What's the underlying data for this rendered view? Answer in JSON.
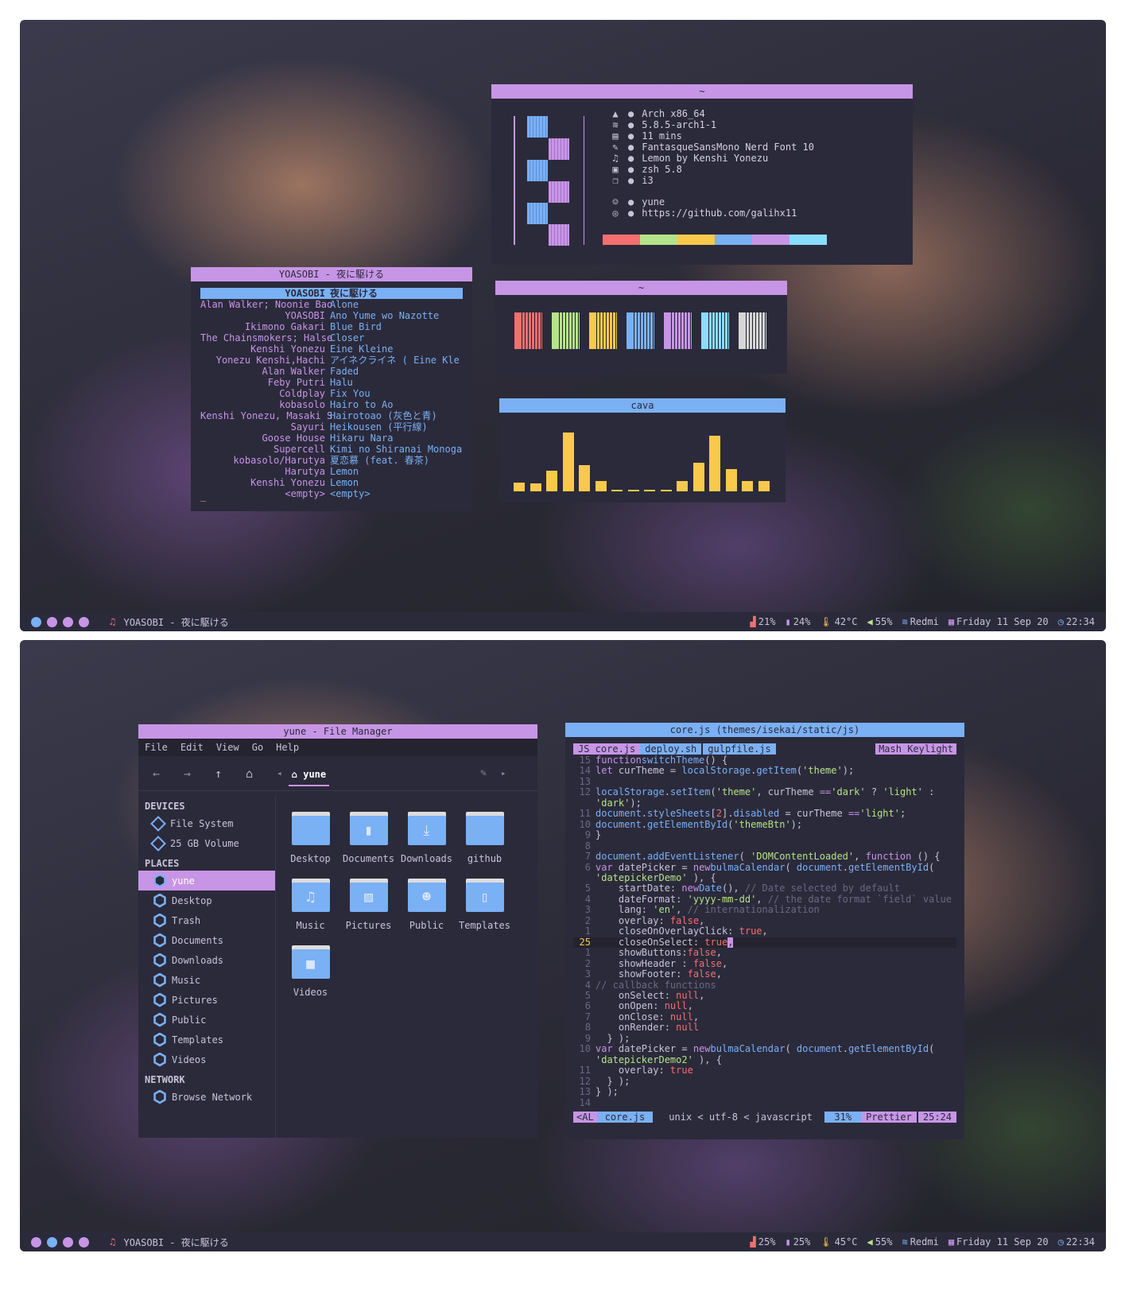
{
  "colors": {
    "purple": "#c795e6",
    "blue": "#7ab0f4",
    "yellow": "#f8c94b",
    "bg": "#2b2a3b"
  },
  "top": {
    "bar": {
      "workspaces": [
        "#7ab0f4",
        "#c795e6",
        "#c795e6",
        "#c795e6"
      ],
      "now_playing": "YOASOBI - 夜に駆ける",
      "cpu": "21%",
      "mem": "24%",
      "temp": "42°C",
      "volume": "55%",
      "wifi": "Redmi",
      "date": "Friday 11 Sep 20",
      "time": "22:34"
    },
    "music": {
      "title": "YOASOBI - 夜に駆ける",
      "rows": [
        {
          "artist": "YOASOBI",
          "track": "夜に駆ける",
          "selected": true
        },
        {
          "artist": "Alan Walker; Noonie Bao",
          "track": "Alone"
        },
        {
          "artist": "YOASOBI",
          "track": "Ano Yume wo Nazotte"
        },
        {
          "artist": "Ikimono Gakari",
          "track": "Blue Bird"
        },
        {
          "artist": "The Chainsmokers; Halse",
          "track": "Closer"
        },
        {
          "artist": "Kenshi Yonezu",
          "track": "Eine Kleine"
        },
        {
          "artist": "Yonezu Kenshi,Hachi",
          "track": "アイネクライネ ( Eine Kle"
        },
        {
          "artist": "Alan Walker",
          "track": "Faded"
        },
        {
          "artist": "Feby Putri",
          "track": "Halu"
        },
        {
          "artist": "Coldplay",
          "track": "Fix You"
        },
        {
          "artist": "kobasolo",
          "track": "Hairo to Ao"
        },
        {
          "artist": "Kenshi Yonezu, Masaki S",
          "track": "Hairotoao (灰色と青)"
        },
        {
          "artist": "Sayuri",
          "track": "Heikousen (平行線)"
        },
        {
          "artist": "Goose House",
          "track": "Hikaru Nara"
        },
        {
          "artist": "Supercell",
          "track": "Kimi no Shiranai Monogata"
        },
        {
          "artist": "kobasolo/Harutya",
          "track": "夏恋慕 (feat. 春茶)"
        },
        {
          "artist": "Harutya",
          "track": "Lemon"
        },
        {
          "artist": "Kenshi Yonezu",
          "track": "Lemon"
        },
        {
          "artist": "<empty>",
          "track": "<empty>"
        }
      ],
      "cursor": "_"
    },
    "neofetch": {
      "title": "~",
      "lines": [
        {
          "icon": "arch-icon",
          "glyph": "▲",
          "text": "Arch x86_64"
        },
        {
          "icon": "kernel-icon",
          "glyph": "≋",
          "text": "5.8.5-arch1-1"
        },
        {
          "icon": "uptime-icon",
          "glyph": "▤",
          "text": "11 mins"
        },
        {
          "icon": "font-icon",
          "glyph": "✎",
          "text": "FantasqueSansMono Nerd Font 10"
        },
        {
          "icon": "music-icon",
          "glyph": "♫",
          "text": "Lemon by Kenshi Yonezu"
        },
        {
          "icon": "shell-icon",
          "glyph": "▣",
          "text": "zsh 5.8"
        },
        {
          "icon": "wm-icon",
          "glyph": "❐",
          "text": "i3"
        },
        {
          "icon": "user-icon",
          "glyph": "☺",
          "text": "yune"
        },
        {
          "icon": "github-icon",
          "glyph": "◎",
          "text": "https://github.com/galihx11"
        }
      ],
      "palette": [
        "#f46f6f",
        "#b5e488",
        "#f8c94b",
        "#7ab0f4",
        "#c795e6",
        "#89ddff"
      ]
    },
    "colors_win": {
      "title": "~",
      "swatches": [
        "#f46f6f",
        "#b5e488",
        "#f8c94b",
        "#7ab0f4",
        "#c795e6",
        "#89ddff",
        "#d6d6d6"
      ]
    },
    "cava": {
      "title": "cava",
      "values": [
        0.15,
        0.13,
        0.35,
        1.0,
        0.44,
        0.17,
        0.02,
        0.02,
        0.02,
        0.02,
        0.17,
        0.48,
        0.95,
        0.38,
        0.17,
        0.17
      ]
    }
  },
  "bottom": {
    "bar": {
      "workspaces": [
        "#c795e6",
        "#7ab0f4",
        "#c795e6",
        "#c795e6"
      ],
      "now_playing": "YOASOBI - 夜に駆ける",
      "cpu": "25%",
      "mem": "25%",
      "temp": "45°C",
      "volume": "55%",
      "wifi": "Redmi",
      "date": "Friday 11 Sep 20",
      "time": "22:34"
    },
    "fm": {
      "title": "yune - File Manager",
      "menu": [
        "File",
        "Edit",
        "View",
        "Go",
        "Help"
      ],
      "path": "yune",
      "devices_header": "DEVICES",
      "devices": [
        "File System",
        "25 GB Volume"
      ],
      "places_header": "PLACES",
      "places": [
        "yune",
        "Desktop",
        "Trash",
        "Documents",
        "Downloads",
        "Music",
        "Pictures",
        "Public",
        "Templates",
        "Videos"
      ],
      "network_header": "NETWORK",
      "network": [
        "Browse Network"
      ],
      "files": [
        {
          "name": "Desktop",
          "icon": "folder-desktop-icon",
          "glyph": ""
        },
        {
          "name": "Documents",
          "icon": "folder-documents-icon",
          "glyph": "▮"
        },
        {
          "name": "Downloads",
          "icon": "folder-downloads-icon",
          "glyph": "⤓"
        },
        {
          "name": "github",
          "icon": "folder-icon",
          "glyph": ""
        },
        {
          "name": "Music",
          "icon": "folder-music-icon",
          "glyph": "♫"
        },
        {
          "name": "Pictures",
          "icon": "folder-pictures-icon",
          "glyph": "▨"
        },
        {
          "name": "Public",
          "icon": "folder-public-icon",
          "glyph": "☻"
        },
        {
          "name": "Templates",
          "icon": "folder-templates-icon",
          "glyph": "▯"
        },
        {
          "name": "Videos",
          "icon": "folder-videos-icon",
          "glyph": "■"
        }
      ]
    },
    "editor": {
      "title": "core.js (themes/isekai/static/js)",
      "tabs": [
        {
          "label": "JS core.js",
          "active": true
        },
        {
          "label": "deploy.sh"
        },
        {
          "label": "gulpfile.js"
        }
      ],
      "theme": "Mash Keylight",
      "status": {
        "mode": "AL",
        "file": "core.js",
        "format": "unix",
        "enc": "utf-8",
        "ft": "javascript",
        "pct": "31%",
        "formatter": "Prettier",
        "pos": "25:24"
      }
    }
  }
}
